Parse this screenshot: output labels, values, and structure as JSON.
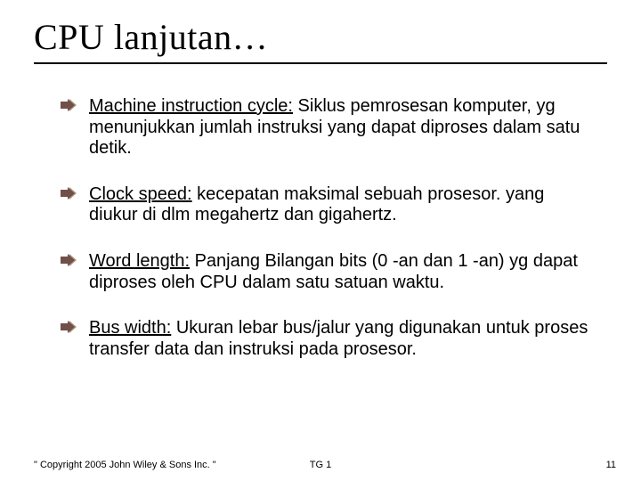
{
  "title": "CPU lanjutan…",
  "bullets": [
    {
      "term": "Machine instruction cycle:",
      "rest": " Siklus pemrosesan komputer, yg menunjukkan jumlah instruksi yang dapat diproses dalam satu detik."
    },
    {
      "term": "Clock speed:",
      "rest": " kecepatan maksimal sebuah prosesor. yang diukur di dlm megahertz dan gigahertz."
    },
    {
      "term": "Word length:",
      "rest": " Panjang Bilangan bits (0 -an dan 1 -an) yg dapat diproses oleh CPU dalam satu satuan waktu."
    },
    {
      "term": "Bus width:",
      "rest": " Ukuran lebar bus/jalur yang digunakan untuk proses transfer data dan instruksi pada prosesor."
    }
  ],
  "footer": {
    "copyright": "\" Copyright 2005 John Wiley & Sons Inc. \"",
    "center": "TG 1",
    "page": "11"
  },
  "colors": {
    "bullet_fill": "#705048",
    "bullet_shadow": "#b09880"
  }
}
